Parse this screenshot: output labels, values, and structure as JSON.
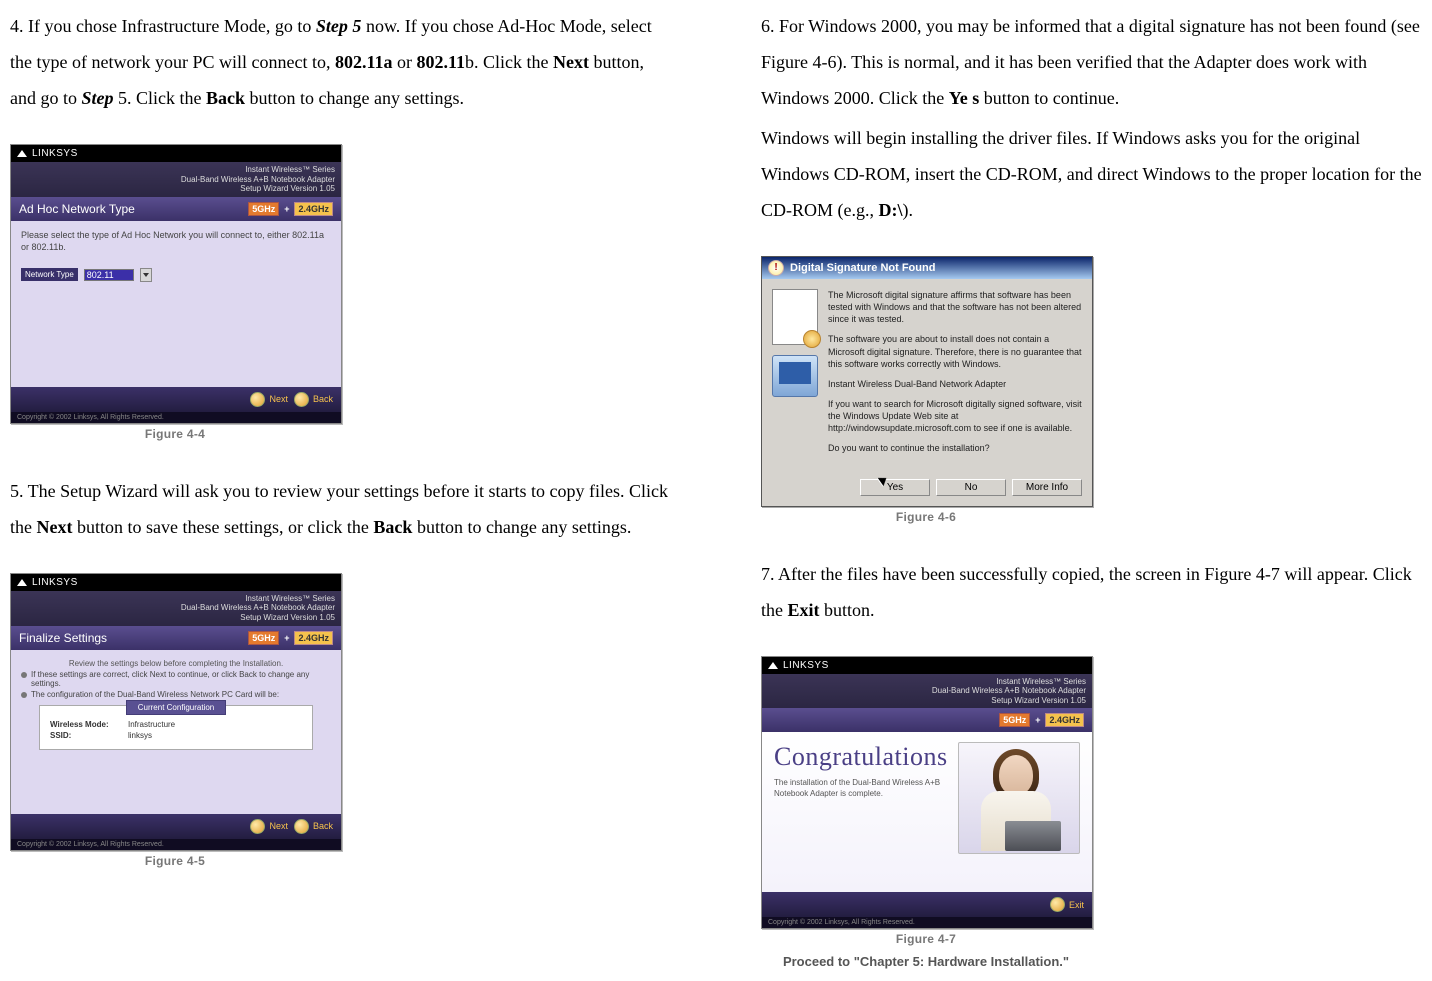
{
  "left": {
    "step4": {
      "prefix": "4. If you chose Infrastructure Mode, go to ",
      "step5ref": "Step 5",
      "mid1": " now. If you chose Ad-Hoc Mode, select the type of network your PC will connect to, ",
      "opt_a": "802.11a",
      "mid2": " or ",
      "opt_b": "802.11",
      "opt_b_suffix": "b. Click the ",
      "next": "Next",
      "mid3": " button, and go to ",
      "step5ref2": "Step",
      "mid3b": " 5. Click the ",
      "back": "Back",
      "tail": " button to change any settings."
    },
    "fig44": {
      "caption": "Figure 4-4",
      "brand": "LINKSYS",
      "top_line1": "Instant Wireless™ Series",
      "top_line2": "Dual-Band Wireless A+B Notebook Adapter",
      "top_line3": "Setup Wizard Version 1.05",
      "title": "Ad Hoc Network Type",
      "ghz5": "5GHz",
      "ghz24": "2.4GHz",
      "blurb": "Please select the type of Ad Hoc Network you will connect to, either 802.11a or 802.11b.",
      "label": "Network Type",
      "value": "802.11",
      "btn_next": "Next",
      "btn_back": "Back",
      "copyright": "Copyright © 2002 Linksys, All Rights Reserved."
    },
    "step5": {
      "prefix": "5. The Setup Wizard will ask you to review your settings before it starts to copy files. Click the ",
      "next": "Next",
      "mid": " button to save these settings, or click the ",
      "back": "Back",
      "tail": " button to change any settings."
    },
    "fig45": {
      "caption": "Figure 4-5",
      "title": "Finalize Settings",
      "review": "Review the settings below before completing the Installation.",
      "guide": "If these settings are correct, click Next to continue, or click Back to change any settings.",
      "box_title": "Current Configuration",
      "box_sub": "The configuration of the Dual-Band Wireless Network PC Card will be:",
      "row1_k": "Wireless Mode:",
      "row1_v": "Infrastructure",
      "row2_k": "SSID:",
      "row2_v": "linksys"
    }
  },
  "right": {
    "step6": {
      "prefix": "6. For Windows 2000, you may be informed that a digital signature has not been found (see Figure 4-6). This is normal, and it has been verified that the Adapter does work with Windows 2000. Click the ",
      "yes": "Ye s",
      "mid": " button to continue.",
      "para2": "Windows will begin installing the driver files. If Windows asks you for the original Windows CD-ROM, insert the CD-ROM, and direct Windows to the proper location for the CD-ROM (e.g., ",
      "drive": "D:\\",
      "tail": ")."
    },
    "fig46": {
      "caption": "Figure 4-6",
      "title": "Digital Signature Not Found",
      "p1": "The Microsoft digital signature affirms that software has been tested with Windows and that the software has not been altered since it was tested.",
      "p2": "The software you are about to install does not contain a Microsoft digital signature. Therefore, there is no guarantee that this software works correctly with Windows.",
      "device": "Instant Wireless Dual-Band Network Adapter",
      "p3": "If you want to search for Microsoft digitally signed software, visit the Windows Update Web site at http://windowsupdate.microsoft.com to see if one is available.",
      "p4": "Do you want to continue the installation?",
      "yes": "Yes",
      "no": "No",
      "more": "More Info"
    },
    "step7": {
      "prefix": "7. After the files have been successfully copied, the screen in Figure 4-7 will appear. Click the ",
      "exit": "Exit",
      "tail": " button."
    },
    "fig47": {
      "caption": "Figure 4-7",
      "congrats": "Congratulations",
      "sub": "The installation of the Dual-Band Wireless A+B Notebook Adapter is complete.",
      "btn": "Exit"
    },
    "proceed": "Proceed to \"Chapter 5: Hardware Installation.\""
  }
}
